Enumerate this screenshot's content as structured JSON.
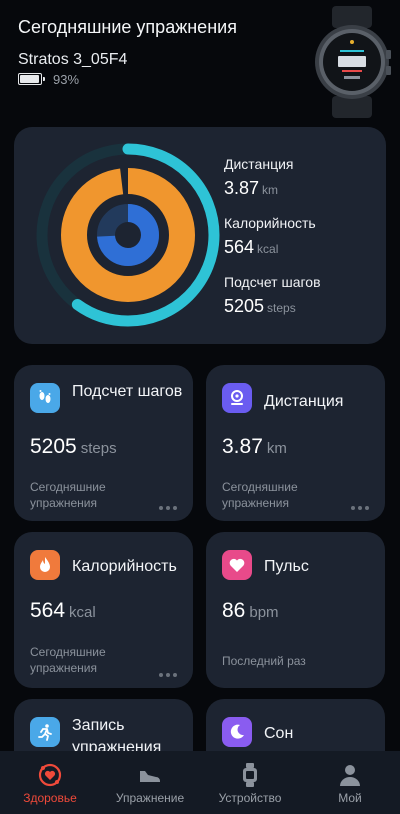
{
  "header": {
    "title": "Сегодняшние упражнения",
    "device_name": "Stratos 3_05F4",
    "battery_percent": "93%",
    "battery_level": 0.93
  },
  "summary": {
    "distance": {
      "label": "Дистанция",
      "value": "3.87",
      "unit": "km"
    },
    "calories": {
      "label": "Калорийность",
      "value": "564",
      "unit": "kcal"
    },
    "steps": {
      "label": "Подсчет шагов",
      "value": "5205",
      "unit": "steps"
    },
    "ring_progress": {
      "distance": 0.6,
      "calories": 0.98,
      "steps": 0.74
    },
    "colors": {
      "distance": "#2ec3d6",
      "calories": "#f0962e",
      "steps": "#2f6fd6",
      "track": "#19323d"
    }
  },
  "tiles": {
    "steps": {
      "name": "Подсчет шагов",
      "value": "5205",
      "unit": "steps",
      "sub": "Сегодняшние упражнения",
      "icon": "footprints-icon",
      "color": "#4aa8e8"
    },
    "distance": {
      "name": "Дистанция",
      "value": "3.87",
      "unit": "km",
      "sub": "Сегодняшние упражнения",
      "icon": "location-pin-icon",
      "color": "#6a5cf0"
    },
    "calories": {
      "name": "Калорийность",
      "value": "564",
      "unit": "kcal",
      "sub": "Сегодняшние упражнения",
      "icon": "flame-icon",
      "color": "#f07a3c"
    },
    "pulse": {
      "name": "Пульс",
      "value": "86",
      "unit": "bpm",
      "sub": "Последний раз",
      "icon": "heart-icon",
      "color": "#e84a8a"
    },
    "workout": {
      "name": "Запись упражнения",
      "icon": "running-icon",
      "color": "#4aa8e8"
    },
    "sleep": {
      "name": "Сон",
      "icon": "moon-icon",
      "color": "#8a5cf0"
    }
  },
  "nav": {
    "items": [
      {
        "label": "Здоровье",
        "icon": "health-icon",
        "active": true
      },
      {
        "label": "Упражнение",
        "icon": "sneaker-icon",
        "active": false
      },
      {
        "label": "Устройство",
        "icon": "watch-icon",
        "active": false
      },
      {
        "label": "Мой",
        "icon": "person-icon",
        "active": false
      }
    ],
    "active_color": "#ef4a3a"
  }
}
